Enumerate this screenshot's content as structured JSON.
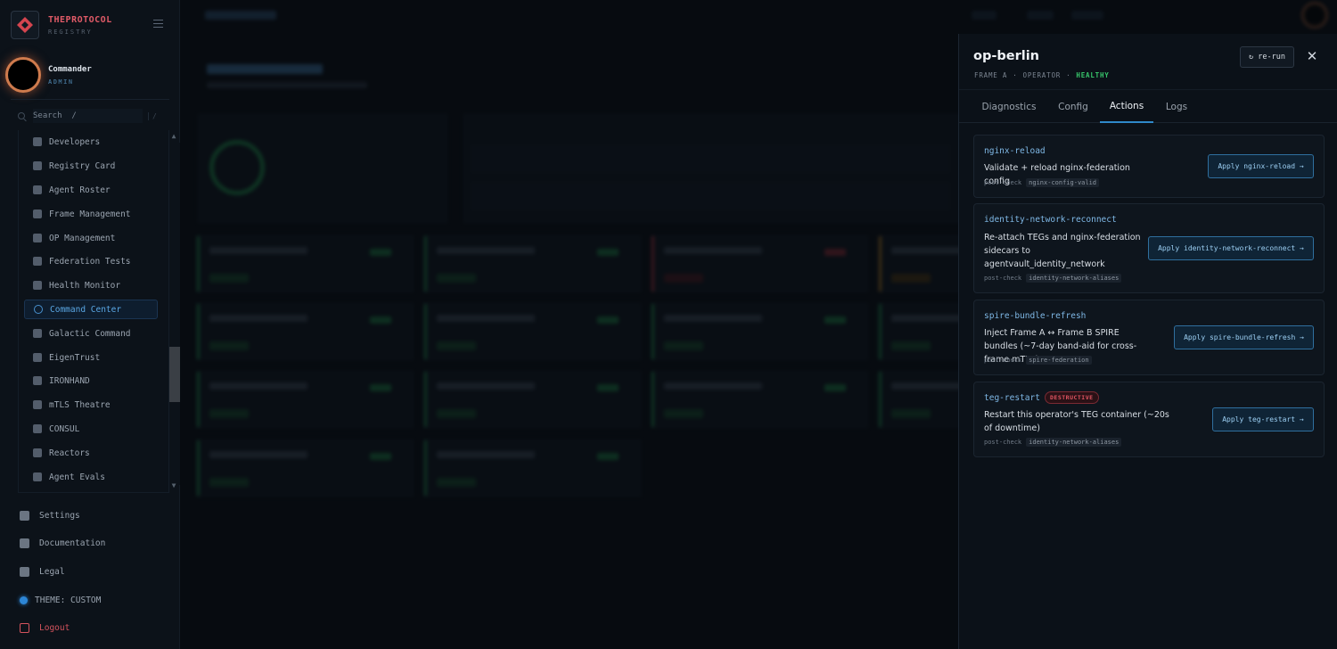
{
  "brand": {
    "name": "THEPROTOCOL",
    "sub": "REGISTRY"
  },
  "user": {
    "name": "Commander",
    "role": "ADMIN"
  },
  "search": {
    "placeholder": "Search  /"
  },
  "nav": {
    "items": [
      {
        "label": "Developers",
        "icon": "developers-icon"
      },
      {
        "label": "Registry Card",
        "icon": "registry-card-icon"
      },
      {
        "label": "Agent Roster",
        "icon": "agent-roster-icon"
      },
      {
        "label": "Frame Management",
        "icon": "frame-management-icon"
      },
      {
        "label": "OP Management",
        "icon": "op-management-icon"
      },
      {
        "label": "Federation Tests",
        "icon": "federation-tests-icon"
      },
      {
        "label": "Health Monitor",
        "icon": "health-monitor-icon"
      },
      {
        "label": "Command Center",
        "icon": "command-center-icon",
        "active": true
      },
      {
        "label": "Galactic Command",
        "icon": "galactic-command-icon"
      },
      {
        "label": "EigenTrust",
        "icon": "eigentrust-icon"
      },
      {
        "label": "IRONHAND",
        "icon": "ironhand-icon"
      },
      {
        "label": "mTLS Theatre",
        "icon": "mtls-theatre-icon"
      },
      {
        "label": "CONSUL",
        "icon": "consul-icon"
      },
      {
        "label": "Reactors",
        "icon": "reactors-icon"
      },
      {
        "label": "Agent Evals",
        "icon": "agent-evals-icon"
      }
    ]
  },
  "bottom": {
    "settings": "Settings",
    "documentation": "Documentation",
    "legal": "Legal",
    "theme": "THEME: CUSTOM",
    "logout": "Logout"
  },
  "drawer": {
    "title": "op-berlin",
    "meta": {
      "frame": "FRAME A",
      "role": "OPERATOR",
      "status": "HEALTHY",
      "sep": "·"
    },
    "rerun_label": "↻ re-run",
    "close_glyph": "✕",
    "tabs": [
      {
        "label": "Diagnostics"
      },
      {
        "label": "Config"
      },
      {
        "label": "Actions",
        "active": true
      },
      {
        "label": "Logs"
      }
    ],
    "postcheck_label": "post-check",
    "actions": [
      {
        "name": "nginx-reload",
        "description": "Validate + reload nginx-federation config",
        "postcheck": "nginx-config-valid",
        "button": "Apply nginx-reload →"
      },
      {
        "name": "identity-network-reconnect",
        "description": "Re-attach TEGs and nginx-federation sidecars to agentvault_identity_network",
        "postcheck": "identity-network-aliases",
        "button": "Apply identity-network-reconnect →"
      },
      {
        "name": "spire-bundle-refresh",
        "description": "Inject Frame A ↔ Frame B SPIRE bundles (~7-day band-aid for cross-frame mTLS)",
        "postcheck": "spire-federation",
        "button": "Apply spire-bundle-refresh →"
      },
      {
        "name": "teg-restart",
        "badge": "DESTRUCTIVE",
        "description": "Restart this operator's TEG container (~20s of downtime)",
        "postcheck": "identity-network-aliases",
        "button": "Apply teg-restart →"
      }
    ]
  },
  "colors": {
    "accent": "#2f89c9",
    "healthy": "#37c46a",
    "danger": "#e05461",
    "brand": "#e05a67"
  }
}
